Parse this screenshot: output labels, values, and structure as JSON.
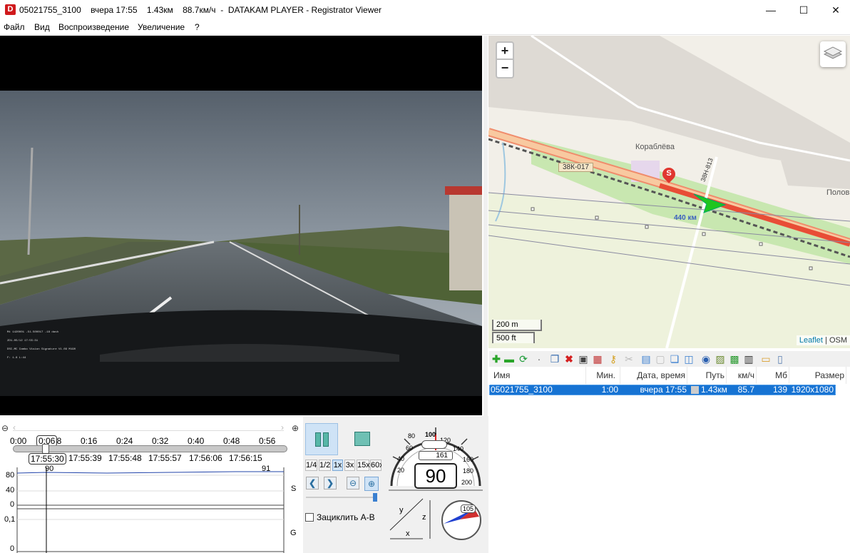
{
  "window": {
    "app_icon": "D",
    "title": "05021755_3100    вчера 17:55    1.43км    88.7км/ч  -  DATAKAM PLAYER - Registrator Viewer",
    "minimize": "—",
    "maximize": "☐",
    "close": "✕"
  },
  "menu": [
    "Файл",
    "Вид",
    "Воспроизведение",
    "Увеличение",
    "?"
  ],
  "map": {
    "zoom_in": "+",
    "zoom_out": "−",
    "place_name": "Кораблёва",
    "place_name_2": "Половне",
    "road_label": "38К-017",
    "road_label_2": "38Н-813",
    "km_label": "440 км",
    "start_marker": "S",
    "scale_metric": "200 m",
    "scale_imperial": "500 ft",
    "attribution_leaflet": "Leaflet",
    "attribution_sep": " | ",
    "attribution_osm": "OSM"
  },
  "toolbar_icons": [
    "add-icon",
    "remove-icon",
    "refresh-icon",
    "dot-icon",
    "copy-icon",
    "delete-icon",
    "save-icon",
    "record-icon",
    "key-icon",
    "cut-icon",
    "add-window-icon",
    "select-icon",
    "cascade-icon",
    "tile-icon",
    "globe-icon",
    "image-icon",
    "export-icon",
    "film-icon",
    "folder-icon",
    "document-icon"
  ],
  "filelist": {
    "headers": [
      "Имя",
      "Мин.",
      "Дата, время",
      "Путь",
      "км/ч",
      "Мб",
      "Размер"
    ],
    "rows": [
      {
        "name": "05021755_3100",
        "min": "1:00",
        "datetime": "вчера 17:55",
        "path": "1.43км",
        "speed": "85.7",
        "mb": "139",
        "size": "1920x1080"
      }
    ]
  },
  "timeline": {
    "ticks": [
      "0:00",
      "0:08",
      "0:16",
      "0:24",
      "0:32",
      "0:40",
      "0:48",
      "0:56"
    ],
    "current_time": "0:06",
    "clock": [
      "17:55:30",
      "17:55:39",
      "17:55:48",
      "17:55:57",
      "17:56:06",
      "17:56:15"
    ],
    "marker_left": "90",
    "marker_right": "91",
    "y_s": [
      "80",
      "40",
      "0"
    ],
    "y_g": [
      "0,1",
      "0"
    ],
    "label_s": "S",
    "label_g": "G",
    "playhead_fraction": 0.1
  },
  "controls": {
    "speeds": [
      "1/4",
      "1/2",
      "1x",
      "3x",
      "15x",
      "60x"
    ],
    "active_speed": "1x",
    "loop_label": "Зациклить А-В"
  },
  "gauge": {
    "speed": "90",
    "odometer": "161",
    "dial": [
      "20",
      "40",
      "60",
      "80",
      "100",
      "120",
      "140",
      "160",
      "180",
      "200"
    ],
    "axis_x": "x",
    "axis_y": "y",
    "axis_z": "z",
    "compass": "105"
  },
  "video": {
    "overlay_lines": [
      "Mt 1420001  -51.500017 -18 dash",
      "2D1-05/12    17:55:31",
      "DSC-MC Combo Vision Signature V1.09 M190",
      "F: 1.8 L:44"
    ]
  }
}
